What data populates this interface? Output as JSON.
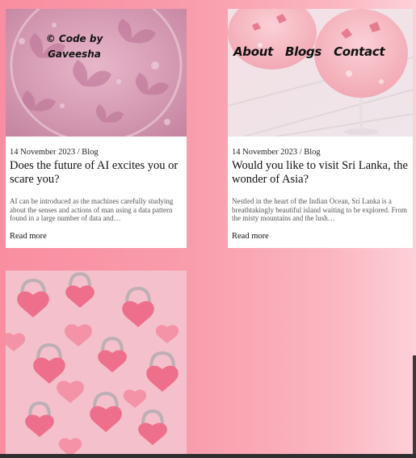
{
  "site": {
    "logo_text": "© Code by Gaveesha"
  },
  "nav": {
    "items": [
      {
        "label": "About"
      },
      {
        "label": "Blogs"
      },
      {
        "label": "Contact"
      }
    ]
  },
  "posts": [
    {
      "date": "14 November 2023",
      "separator": "/",
      "category": "Blog",
      "title": "Does the future of AI excites you or scare you?",
      "excerpt": "AI can be introduced as the machines carefully studying about the senses and actions of man using a data pattern found in a large number of data and…",
      "read_more": "Read more",
      "image_icon": "pink-butterfly-drink-image"
    },
    {
      "date": "14 November 2023",
      "separator": "/",
      "category": "Blog",
      "title": "Would you like to visit Sri Lanka, the wonder of Asia?",
      "excerpt": "Nestled in the heart of the Indian Ocean, Sri Lanka is a breathtakingly beautiful island waiting to be explored. From the misty mountains and the lush…",
      "read_more": "Read more",
      "image_icon": "pink-cocktail-glasses-image"
    }
  ],
  "gallery": {
    "image_icon": "heart-padlocks-image"
  },
  "colors": {
    "accent_pink": "#f98ea1",
    "light_pink": "#fdd0d8",
    "text_dark": "#111111"
  }
}
